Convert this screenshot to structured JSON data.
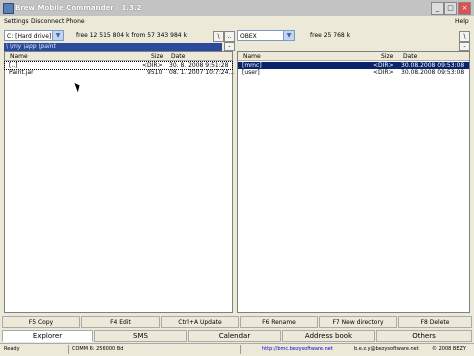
{
  "window": {
    "title": "Brew Mobile Commander - 1.3.2",
    "controls": [
      "_",
      "□",
      "×"
    ]
  },
  "menu": {
    "items": [
      "Settings",
      "Disconnect",
      "Phone"
    ],
    "help": "Help"
  },
  "left": {
    "drive": "C: [Hard drive]",
    "free": "free 12 515 804 k from 57 343 984 k",
    "path": "\\ \\my \\app \\paint",
    "col_name": "Name",
    "col_size": "Size",
    "col_date": "Date",
    "rows": [
      {
        "name": "[..]",
        "size": "<DIR>",
        "date": "30. 8. 2008 9:51:28"
      },
      {
        "name": "Paint.jar",
        "size": "9510",
        "date": "08. 1. 2007 10:7:24..."
      }
    ]
  },
  "right": {
    "drive": "OBEX",
    "free": "free 25 768 k",
    "col_name": "Name",
    "col_size": "Size",
    "col_date": "Date",
    "rows": [
      {
        "name": "[mmc]",
        "size": "<DIR>",
        "date": "30.08.2008 09:53:08"
      },
      {
        "name": "[user]",
        "size": "<DIR>",
        "date": "30.08.2008 09:53:08"
      }
    ]
  },
  "buttons": {
    "back": "\\",
    "up": "..",
    "left_side": "-",
    "right_side": "-"
  },
  "fkeys": [
    "F5 Copy",
    "F4 Edit",
    "Ctrl+A Update",
    "F6 Rename",
    "F7 New directory",
    "F8 Delete"
  ],
  "tabs": [
    "Explorer",
    "SMS",
    "Calendar",
    "Address book",
    "Others"
  ],
  "status": {
    "conn": "Ready",
    "port": "COMM 6: 256000 Bd",
    "url": "http://bmc.bezysoftware.net",
    "email": "b.e.z.y@bezysoftware.net",
    "copyright": "© 2008 BEZY"
  }
}
